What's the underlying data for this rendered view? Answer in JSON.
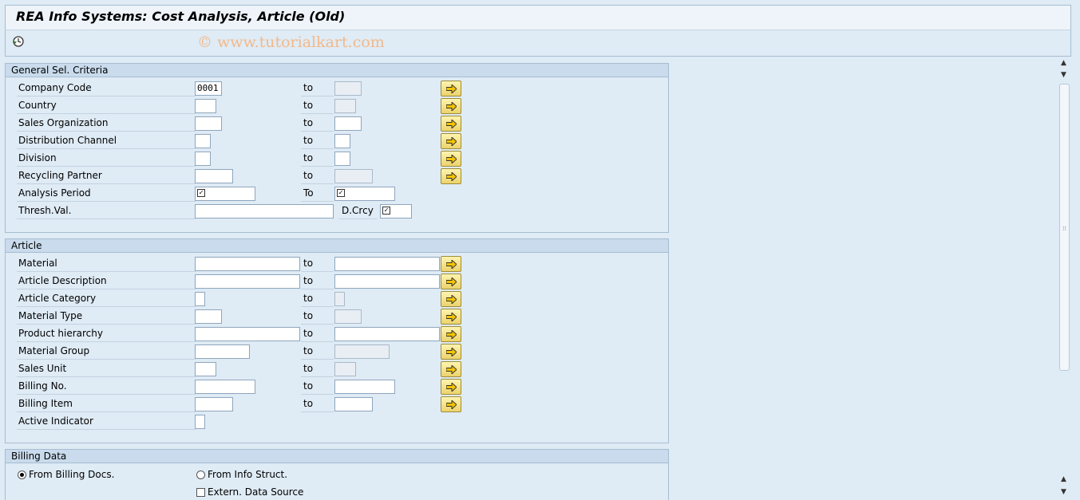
{
  "window": {
    "title": "REA Info Systems: Cost Analysis, Article (Old)"
  },
  "toolbar": {
    "watermark": "© www.tutorialkart.com",
    "execute_icon": "execute-clock-icon"
  },
  "general": {
    "header": "General Sel. Criteria",
    "to_label": "to",
    "rows": [
      {
        "label": "Company Code",
        "from": "0001"
      },
      {
        "label": "Country",
        "from": ""
      },
      {
        "label": "Sales Organization",
        "from": ""
      },
      {
        "label": "Distribution Channel",
        "from": ""
      },
      {
        "label": "Division",
        "from": ""
      },
      {
        "label": "Recycling Partner",
        "from": ""
      }
    ],
    "analysis_period": {
      "label": "Analysis Period",
      "to_label": "To"
    },
    "thresh": {
      "label": "Thresh.Val.",
      "currency_label": "D.Crcy"
    }
  },
  "article": {
    "header": "Article",
    "to_label": "to",
    "rows": [
      {
        "label": "Material"
      },
      {
        "label": "Article Description"
      },
      {
        "label": "Article Category"
      },
      {
        "label": "Material Type"
      },
      {
        "label": "Product hierarchy"
      },
      {
        "label": "Material Group"
      },
      {
        "label": "Sales Unit"
      },
      {
        "label": "Billing No."
      },
      {
        "label": "Billing Item"
      }
    ],
    "active_indicator": {
      "label": "Active Indicator"
    }
  },
  "billing": {
    "header": "Billing Data",
    "opt_billing_docs": "From Billing Docs.",
    "opt_info_struct": "From Info Struct.",
    "extern_label": "Extern. Data Source"
  },
  "colors": {
    "accent": "#dfebf5",
    "header": "#c9dbec",
    "multi_button": "#ecd36a"
  }
}
